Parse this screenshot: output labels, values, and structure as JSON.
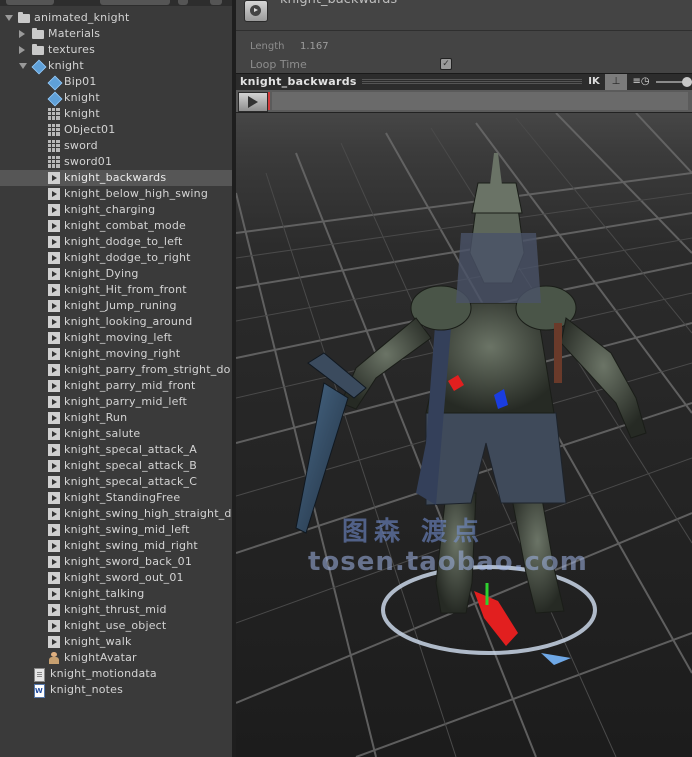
{
  "hierarchy": {
    "items": [
      {
        "label": "animated_knight",
        "icon": "folder-icon",
        "depth": 0,
        "expand": "open"
      },
      {
        "label": "Materials",
        "icon": "folder-icon",
        "depth": 1,
        "expand": "closed"
      },
      {
        "label": "textures",
        "icon": "folder-icon",
        "depth": 1,
        "expand": "closed"
      },
      {
        "label": "knight",
        "icon": "cube-icon",
        "depth": 1,
        "expand": "open"
      },
      {
        "label": "Bip01",
        "icon": "cube-icon",
        "depth": 2
      },
      {
        "label": "knight",
        "icon": "cube-icon",
        "depth": 2
      },
      {
        "label": "knight",
        "icon": "mesh-icon",
        "depth": 2
      },
      {
        "label": "Object01",
        "icon": "mesh-icon",
        "depth": 2
      },
      {
        "label": "sword",
        "icon": "mesh-icon",
        "depth": 2
      },
      {
        "label": "sword01",
        "icon": "mesh-icon",
        "depth": 2
      },
      {
        "label": "knight_backwards",
        "icon": "animation-clip-icon",
        "depth": 2,
        "selected": true
      },
      {
        "label": "knight_below_high_swing",
        "icon": "animation-clip-icon",
        "depth": 2
      },
      {
        "label": "knight_charging",
        "icon": "animation-clip-icon",
        "depth": 2
      },
      {
        "label": "knight_combat_mode",
        "icon": "animation-clip-icon",
        "depth": 2
      },
      {
        "label": "knight_dodge_to_left",
        "icon": "animation-clip-icon",
        "depth": 2
      },
      {
        "label": "knight_dodge_to_right",
        "icon": "animation-clip-icon",
        "depth": 2
      },
      {
        "label": "knight_Dying",
        "icon": "animation-clip-icon",
        "depth": 2
      },
      {
        "label": "knight_Hit_from_front",
        "icon": "animation-clip-icon",
        "depth": 2
      },
      {
        "label": "knight_Jump_runing",
        "icon": "animation-clip-icon",
        "depth": 2
      },
      {
        "label": "knight_looking_around",
        "icon": "animation-clip-icon",
        "depth": 2
      },
      {
        "label": "knight_moving_left",
        "icon": "animation-clip-icon",
        "depth": 2
      },
      {
        "label": "knight_moving_right",
        "icon": "animation-clip-icon",
        "depth": 2
      },
      {
        "label": "knight_parry_from_stright_do",
        "icon": "animation-clip-icon",
        "depth": 2
      },
      {
        "label": "knight_parry_mid_front",
        "icon": "animation-clip-icon",
        "depth": 2
      },
      {
        "label": "knight_parry_mid_left",
        "icon": "animation-clip-icon",
        "depth": 2
      },
      {
        "label": "knight_Run",
        "icon": "animation-clip-icon",
        "depth": 2
      },
      {
        "label": "knight_salute",
        "icon": "animation-clip-icon",
        "depth": 2
      },
      {
        "label": "knight_specal_attack_A",
        "icon": "animation-clip-icon",
        "depth": 2
      },
      {
        "label": "knight_specal_attack_B",
        "icon": "animation-clip-icon",
        "depth": 2
      },
      {
        "label": "knight_specal_attack_C",
        "icon": "animation-clip-icon",
        "depth": 2
      },
      {
        "label": "knight_StandingFree",
        "icon": "animation-clip-icon",
        "depth": 2
      },
      {
        "label": "knight_swing_high_straight_d",
        "icon": "animation-clip-icon",
        "depth": 2
      },
      {
        "label": "knight_swing_mid_left",
        "icon": "animation-clip-icon",
        "depth": 2
      },
      {
        "label": "knight_swing_mid_right",
        "icon": "animation-clip-icon",
        "depth": 2
      },
      {
        "label": "knight_sword_back_01",
        "icon": "animation-clip-icon",
        "depth": 2
      },
      {
        "label": "knight_sword_out_01",
        "icon": "animation-clip-icon",
        "depth": 2
      },
      {
        "label": "knight_talking",
        "icon": "animation-clip-icon",
        "depth": 2
      },
      {
        "label": "knight_thrust_mid",
        "icon": "animation-clip-icon",
        "depth": 2
      },
      {
        "label": "knight_use_object",
        "icon": "animation-clip-icon",
        "depth": 2
      },
      {
        "label": "knight_walk",
        "icon": "animation-clip-icon",
        "depth": 2
      },
      {
        "label": "knightAvatar",
        "icon": "avatar-icon",
        "depth": 2
      },
      {
        "label": "knight_motiondata",
        "icon": "document-icon",
        "depth": 1
      },
      {
        "label": "knight_notes",
        "icon": "word-document-icon",
        "depth": 1
      }
    ]
  },
  "inspector": {
    "clip_title": "knight_backwards",
    "length_label": "Length",
    "length_value": "1.167",
    "loop_time_label": "Loop Time",
    "loop_time_checked": "✓"
  },
  "preview": {
    "name": "knight_backwards",
    "ik_label": "IK",
    "pivot_icon": "pivot-icon",
    "speed_icon": "playback-speed-icon",
    "speed_glyph": "≡◷"
  },
  "viewport": {
    "watermark_line1": "图森 渡点",
    "watermark_line2": "tosen.taobao.com"
  },
  "colors": {
    "selection": "#565656",
    "scrub": "#d23a3a",
    "accent_blue": "#5fa0d8"
  }
}
